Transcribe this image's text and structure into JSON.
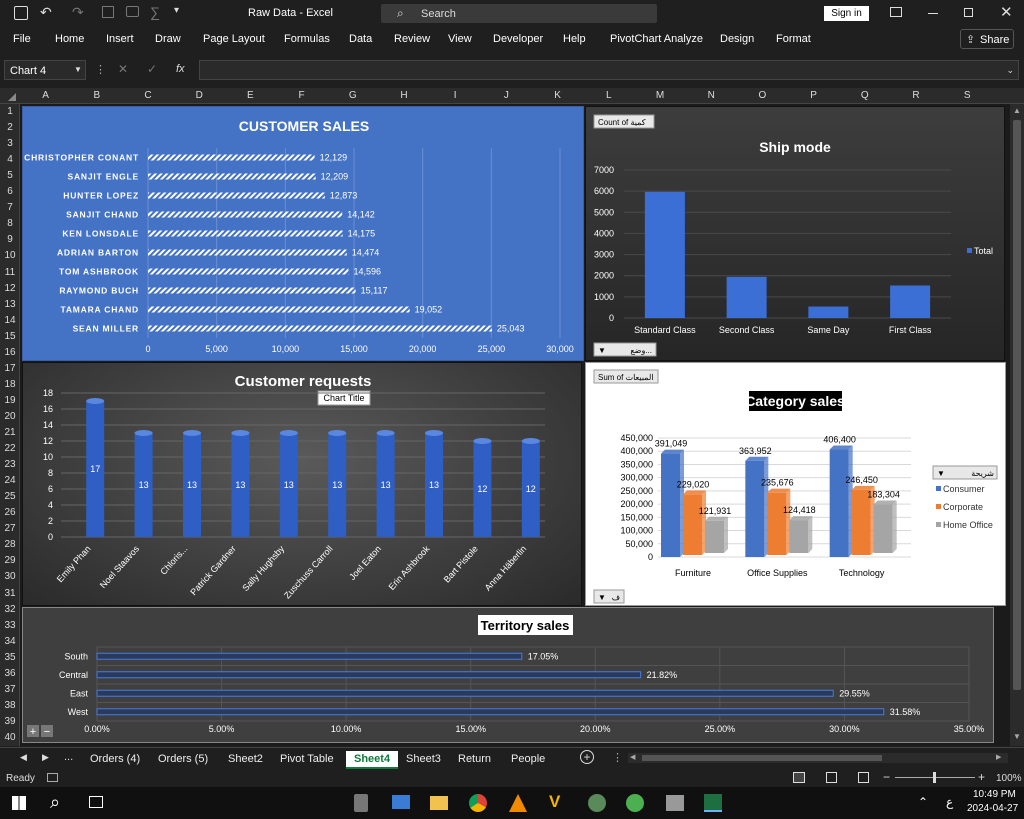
{
  "titlebar": {
    "title": "Raw Data  -  Excel",
    "search_placeholder": "Search",
    "signin": "Sign in"
  },
  "menu": [
    "File",
    "Home",
    "Insert",
    "Draw",
    "Page Layout",
    "Formulas",
    "Data",
    "Review",
    "View",
    "Developer",
    "Help",
    "PivotChart Analyze",
    "Design",
    "Format"
  ],
  "share": "Share",
  "formula": {
    "namebox": "Chart 4",
    "fx": "fx"
  },
  "columns": [
    "A",
    "B",
    "C",
    "D",
    "E",
    "F",
    "G",
    "H",
    "I",
    "J",
    "K",
    "L",
    "M",
    "N",
    "O",
    "P",
    "Q",
    "R",
    "S"
  ],
  "rows": [
    "1",
    "2",
    "3",
    "4",
    "5",
    "6",
    "7",
    "8",
    "9",
    "10",
    "11",
    "12",
    "13",
    "14",
    "15",
    "16",
    "17",
    "18",
    "19",
    "20",
    "21",
    "22",
    "23",
    "24",
    "25",
    "26",
    "27",
    "28",
    "29",
    "30",
    "31",
    "32",
    "33",
    "34",
    "35",
    "36",
    "37",
    "38",
    "39",
    "40"
  ],
  "charts": {
    "customer_sales": {
      "title": "CUSTOMER SALES",
      "bg": "#4472c4",
      "categories": [
        "CHRISTOPHER CONANT",
        "SANJIT ENGLE",
        "HUNTER LOPEZ",
        "SANJIT CHAND",
        "KEN LONSDALE",
        "ADRIAN BARTON",
        "TOM ASHBROOK",
        "RAYMOND BUCH",
        "TAMARA CHAND",
        "SEAN MILLER"
      ],
      "values": [
        12129,
        12209,
        12873,
        14142,
        14175,
        14474,
        14596,
        15117,
        19052,
        25043
      ],
      "labels": [
        "12,129",
        "12,209",
        "12,873",
        "14,142",
        "14,175",
        "14,474",
        "14,596",
        "15,117",
        "19,052",
        "25,043"
      ],
      "xticks": [
        "0",
        "5,000",
        "10,000",
        "15,000",
        "20,000",
        "25,000",
        "30,000"
      ],
      "xlim": [
        0,
        30000
      ]
    },
    "ship_mode": {
      "title": "Ship mode",
      "field_button": "Count of كمية",
      "axis_button": "وضع...",
      "legend": "Total",
      "categories": [
        "Standard Class",
        "Second Class",
        "Same Day",
        "First Class"
      ],
      "values": [
        5968,
        1945,
        543,
        1538
      ],
      "yticks": [
        "0",
        "1000",
        "2000",
        "3000",
        "4000",
        "5000",
        "6000",
        "7000"
      ],
      "ylim": [
        0,
        7000
      ]
    },
    "customer_requests": {
      "title": "Customer requests",
      "tooltip": "Chart Title",
      "categories": [
        "Emily Phan",
        "Noel Staavos",
        "Chloris...",
        "Patrick Gardner",
        "Sally Hughsby",
        "Zuschuss Carroll",
        "Joel Eaton",
        "Erin Ashbrook",
        "Bart Pistole",
        "Anna Häberlin"
      ],
      "values": [
        17,
        13,
        13,
        13,
        13,
        13,
        13,
        13,
        12,
        12
      ],
      "labels": [
        "17",
        "13",
        "13",
        "13",
        "13",
        "13",
        "13",
        "13",
        "12",
        "12"
      ],
      "yticks": [
        "0",
        "2",
        "4",
        "6",
        "8",
        "10",
        "12",
        "14",
        "16",
        "18"
      ],
      "ylim": [
        0,
        18
      ]
    },
    "category_sales": {
      "title": "Category sales",
      "field_button": "Sum of المبيعات",
      "axis_button": "ف",
      "legend_title": "شريحة",
      "categories": [
        "Furniture",
        "Office Supplies",
        "Technology"
      ],
      "series": [
        {
          "name": "Consumer",
          "color": "#4472c4",
          "values": [
            391049,
            363952,
            406400
          ],
          "labels": [
            "391,049",
            "363,952",
            "406,400"
          ]
        },
        {
          "name": "Corporate",
          "color": "#ed7d31",
          "values": [
            229020,
            235676,
            246450
          ],
          "labels": [
            "229,020",
            "235,676",
            "246,450"
          ]
        },
        {
          "name": "Home Office",
          "color": "#a5a5a5",
          "values": [
            121931,
            124418,
            183304
          ],
          "labels": [
            "121,931",
            "124,418",
            "183,304"
          ]
        }
      ],
      "yticks": [
        "0",
        "50,000",
        "100,000",
        "150,000",
        "200,000",
        "250,000",
        "300,000",
        "350,000",
        "400,000",
        "450,000"
      ],
      "ylim": [
        0,
        450000
      ]
    },
    "territory_sales": {
      "title": "Territory sales",
      "categories": [
        "South",
        "Central",
        "East",
        "West"
      ],
      "values": [
        17.05,
        21.82,
        29.55,
        31.58
      ],
      "labels": [
        "17.05%",
        "21.82%",
        "29.55%",
        "31.58%"
      ],
      "xticks": [
        "0.00%",
        "5.00%",
        "10.00%",
        "15.00%",
        "20.00%",
        "25.00%",
        "30.00%",
        "35.00%"
      ],
      "xlim": [
        0,
        35
      ]
    }
  },
  "sheets": [
    "Orders (4)",
    "Orders (5)",
    "Sheet2",
    "Pivot Table",
    "Sheet4",
    "Sheet3",
    "Return",
    "People"
  ],
  "active_sheet": "Sheet4",
  "status": {
    "ready": "Ready",
    "zoom": "100%"
  },
  "clock": {
    "time": "10:49 PM",
    "date": "2024-04-27"
  },
  "lang": "ع"
}
